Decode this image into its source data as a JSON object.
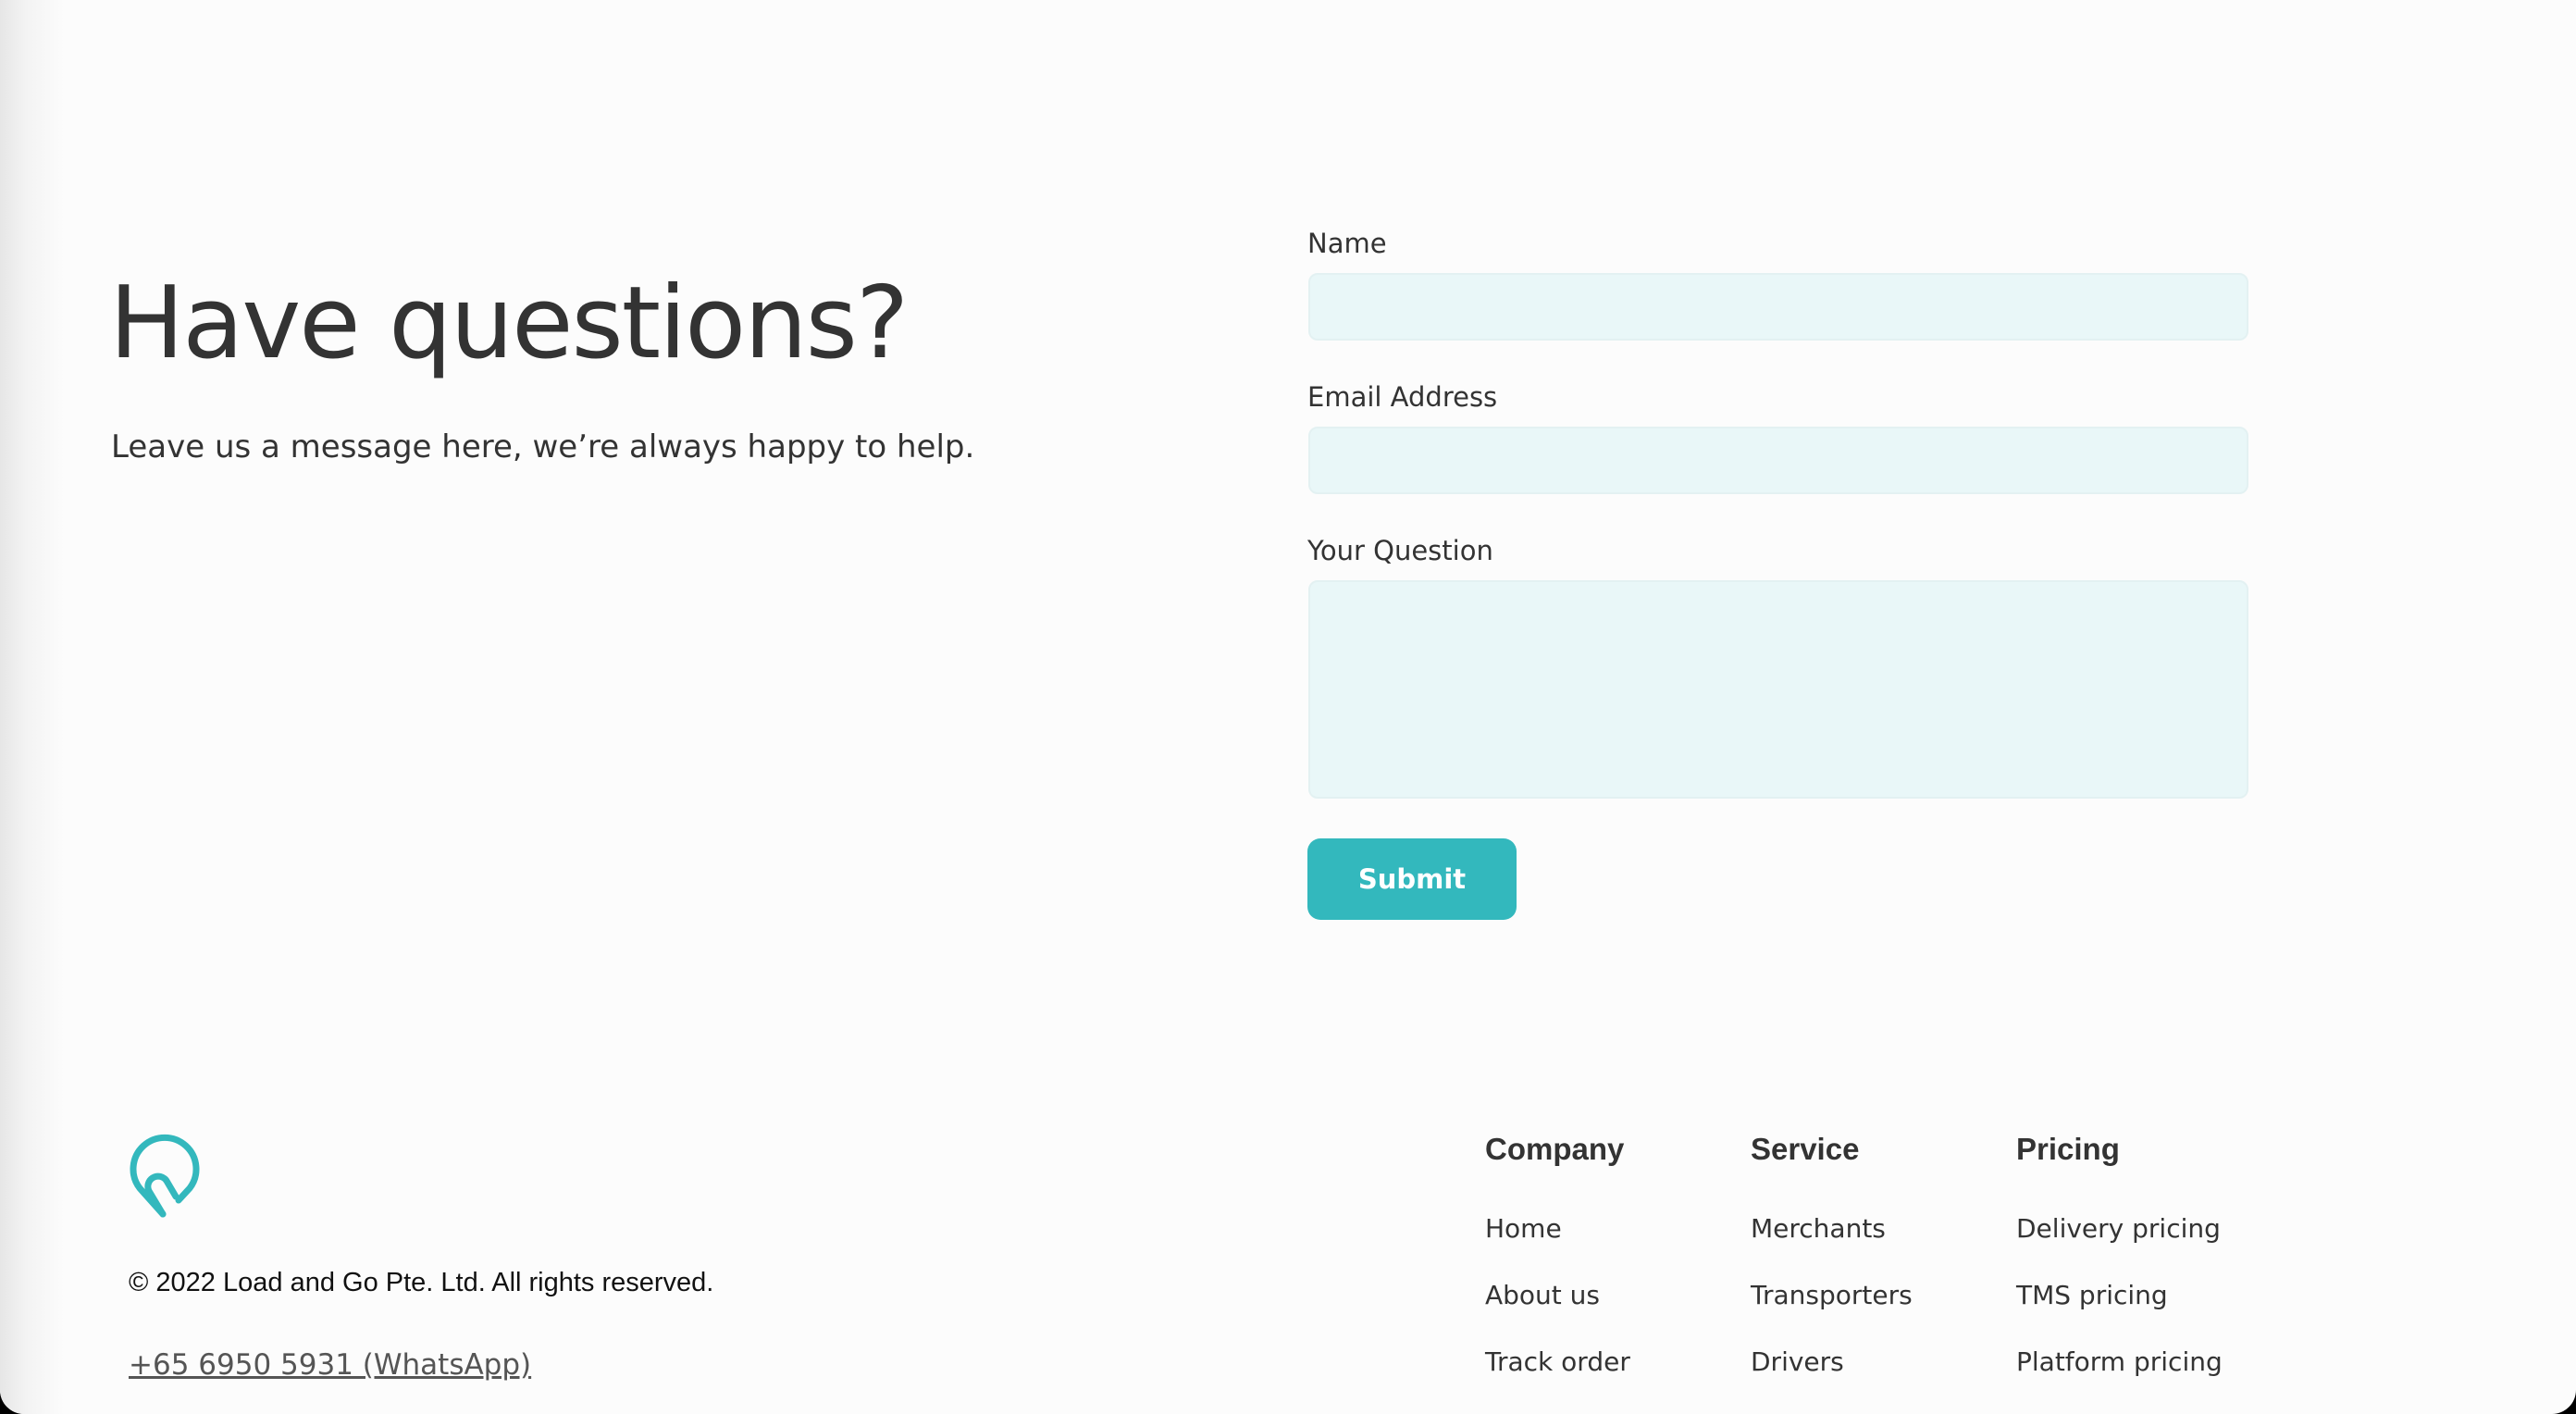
{
  "hero": {
    "title": "Have questions?",
    "subtitle": "Leave us a message here, we’re always happy to help."
  },
  "form": {
    "name_label": "Name",
    "name_value": "",
    "email_label": "Email Address",
    "email_value": "",
    "question_label": "Your Question",
    "question_value": "",
    "submit_label": "Submit"
  },
  "footer": {
    "logo_icon": "location-pin-logo-icon",
    "copyright": "© 2022 Load and Go Pte. Ltd. All rights reserved.",
    "phone": "+65 6950 5931 (WhatsApp)",
    "columns": [
      {
        "title": "Company",
        "links": [
          "Home",
          "About us",
          "Track order"
        ]
      },
      {
        "title": "Service",
        "links": [
          "Merchants",
          "Transporters",
          "Drivers"
        ]
      },
      {
        "title": "Pricing",
        "links": [
          "Delivery pricing",
          "TMS pricing",
          "Platform pricing"
        ]
      }
    ]
  },
  "colors": {
    "accent": "#33b8bd",
    "input_bg": "#e9f7f8",
    "text": "#333333",
    "page_bg": "#fcfcfc"
  }
}
